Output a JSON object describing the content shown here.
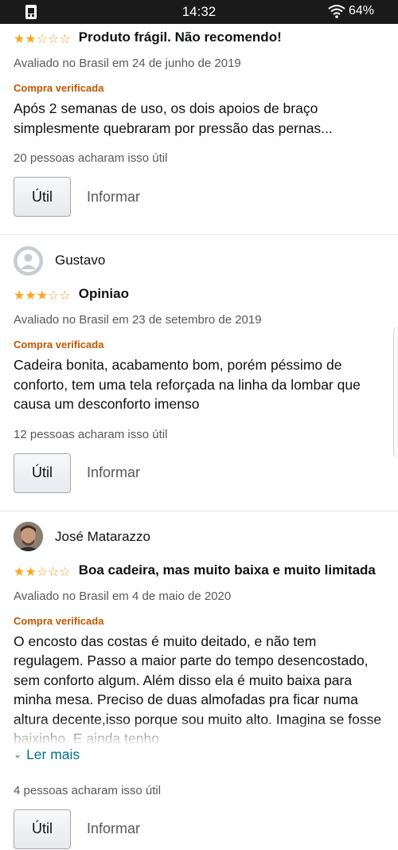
{
  "status_bar": {
    "time": "14:32",
    "battery": "64%",
    "left_icon": "phone-sim-icon",
    "right_icon": "wifi-icon"
  },
  "colors": {
    "star": "#ffa41c",
    "verified": "#c45500",
    "link": "#007185",
    "muted": "#565959"
  },
  "reviews": [
    {
      "stars": 2,
      "title": "Produto frágil. Não recomendo!",
      "date": "Avaliado no Brasil em 24 de junho de 2019",
      "verified": "Compra verificada",
      "body": "Após 2 semanas de uso, os dois apoios de braço simplesmente quebraram por pressão das pernas...",
      "helpful": "20 pessoas acharam isso útil",
      "helpful_button": "Útil",
      "report_button": "Informar"
    },
    {
      "reviewer": "Gustavo",
      "stars": 3,
      "title": "Opiniao",
      "date": "Avaliado no Brasil em 23 de setembro de 2019",
      "verified": "Compra verificada",
      "body": "Cadeira bonita, acabamento bom, porém péssimo de conforto, tem uma tela reforçada na linha da lombar que causa um desconforto imenso",
      "helpful": "12 pessoas acharam isso útil",
      "helpful_button": "Útil",
      "report_button": "Informar"
    },
    {
      "reviewer": "José Matarazzo",
      "stars": 2,
      "title": "Boa cadeira, mas muito baixa e muito limitada",
      "date": "Avaliado no Brasil em 4 de maio de 2020",
      "verified": "Compra verificada",
      "body": "O encosto das costas é muito deitado, e não tem regulagem. Passo a maior parte do tempo desencostado, sem conforto algum. Além disso ela é muito baixa para minha mesa. Preciso de duas almofadas pra ficar numa altura decente,isso porque sou muito alto. Imagina se fosse baixinho. E ainda tenho",
      "read_more": "Ler mais",
      "helpful": "4 pessoas acharam isso útil",
      "helpful_button": "Útil",
      "report_button": "Informar"
    }
  ]
}
